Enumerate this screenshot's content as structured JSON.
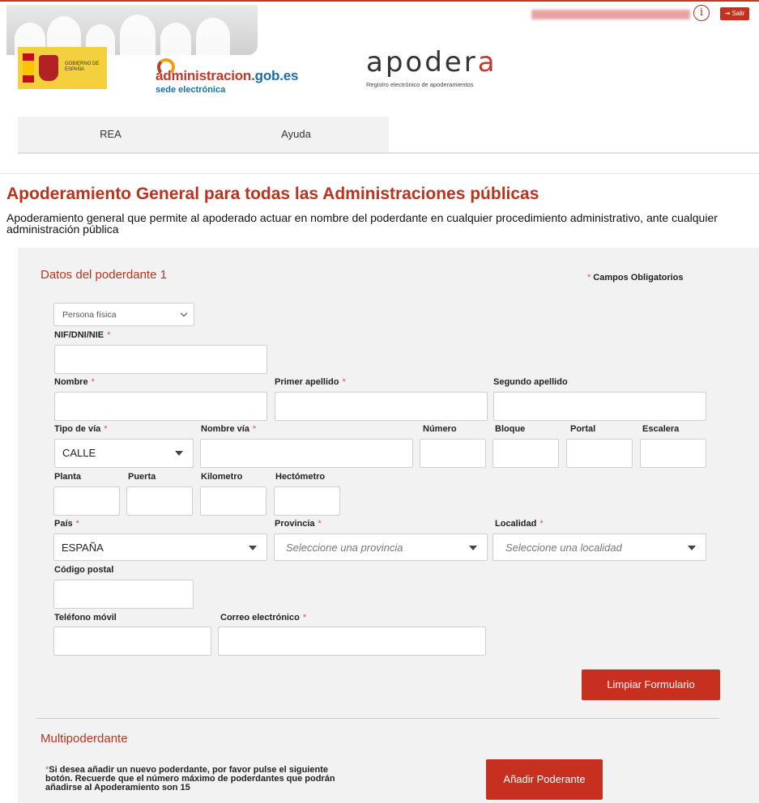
{
  "header": {
    "exit_label": "Salir",
    "info_icon": "info-icon",
    "logos": {
      "gobierno_text": "GOBIERNO DE ESPAÑA",
      "admin_main_prefix": "administracion",
      "admin_main_suffix": ".gob.es",
      "admin_sub": "sede electrónica",
      "apodera_brand_a": "apoder",
      "apodera_brand_b": "a",
      "apodera_tagline": "Registro electrónico de apoderamientos"
    }
  },
  "nav": {
    "items": [
      {
        "label": "REA"
      },
      {
        "label": "Ayuda"
      }
    ]
  },
  "page": {
    "title": "Apoderamiento General para todas las Administraciones públicas",
    "description": "Apoderamiento general que permite al apoderado actuar en nombre del poderdante en cualquier procedimiento administrativo, ante cualquier administración pública"
  },
  "form": {
    "section_title": "Datos del poderdante 1",
    "mandatory_note": "Campos Obligatorios",
    "person_type": "Persona física",
    "labels": {
      "nif": "NIF/DNI/NIE",
      "nombre": "Nombre",
      "primer_apellido": "Primer apellido",
      "segundo_apellido": "Segundo apellido",
      "tipo_via": "Tipo de vía",
      "nombre_via": "Nombre vía",
      "numero": "Número",
      "bloque": "Bloque",
      "portal": "Portal",
      "escalera": "Escalera",
      "planta": "Planta",
      "puerta": "Puerta",
      "kilometro": "Kilometro",
      "hectometro": "Hectómetro",
      "pais": "País",
      "provincia": "Provincia",
      "localidad": "Localidad",
      "codigo_postal": "Código postal",
      "telefono": "Teléfono móvil",
      "correo": "Correo electrónico"
    },
    "values": {
      "tipo_via": "CALLE",
      "pais": "ESPAÑA"
    },
    "placeholders": {
      "provincia": "Seleccione una provincia",
      "localidad": "Seleccione una localidad"
    },
    "clear_button": "Limpiar Formulario"
  },
  "multi": {
    "title": "Multipoderdante",
    "note_asterisk": "*",
    "note": "Si desea añadir un nuevo poderdante, por favor pulse el siguiente botón. Recuerde que el número máximo de poderdantes que podrán añadirse al Apoderamiento son 15",
    "add_button": "Añadir Poderante"
  },
  "colors": {
    "accent": "#c7301f",
    "panel": "#f2f2f2"
  }
}
